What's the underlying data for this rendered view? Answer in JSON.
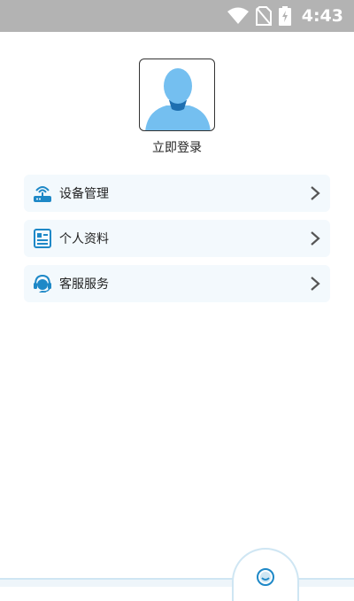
{
  "status_bar": {
    "time": "4:43",
    "icons": [
      "wifi-icon",
      "no-sim-icon",
      "battery-charging-icon"
    ]
  },
  "profile": {
    "avatar_icon": "default-user-avatar",
    "login_label": "立即登录"
  },
  "menu": [
    {
      "label": "设备管理",
      "icon": "router-icon"
    },
    {
      "label": "个人资料",
      "icon": "profile-card-icon"
    },
    {
      "label": "客服服务",
      "icon": "customer-service-icon"
    }
  ],
  "bottom_nav": {
    "center_icon": "smile-face-icon"
  },
  "colors": {
    "status_bar": "#b3b3b3",
    "menu_bg": "#f3f9fd",
    "accent": "#1e88c7",
    "avatar_blue": "#74bff0"
  }
}
